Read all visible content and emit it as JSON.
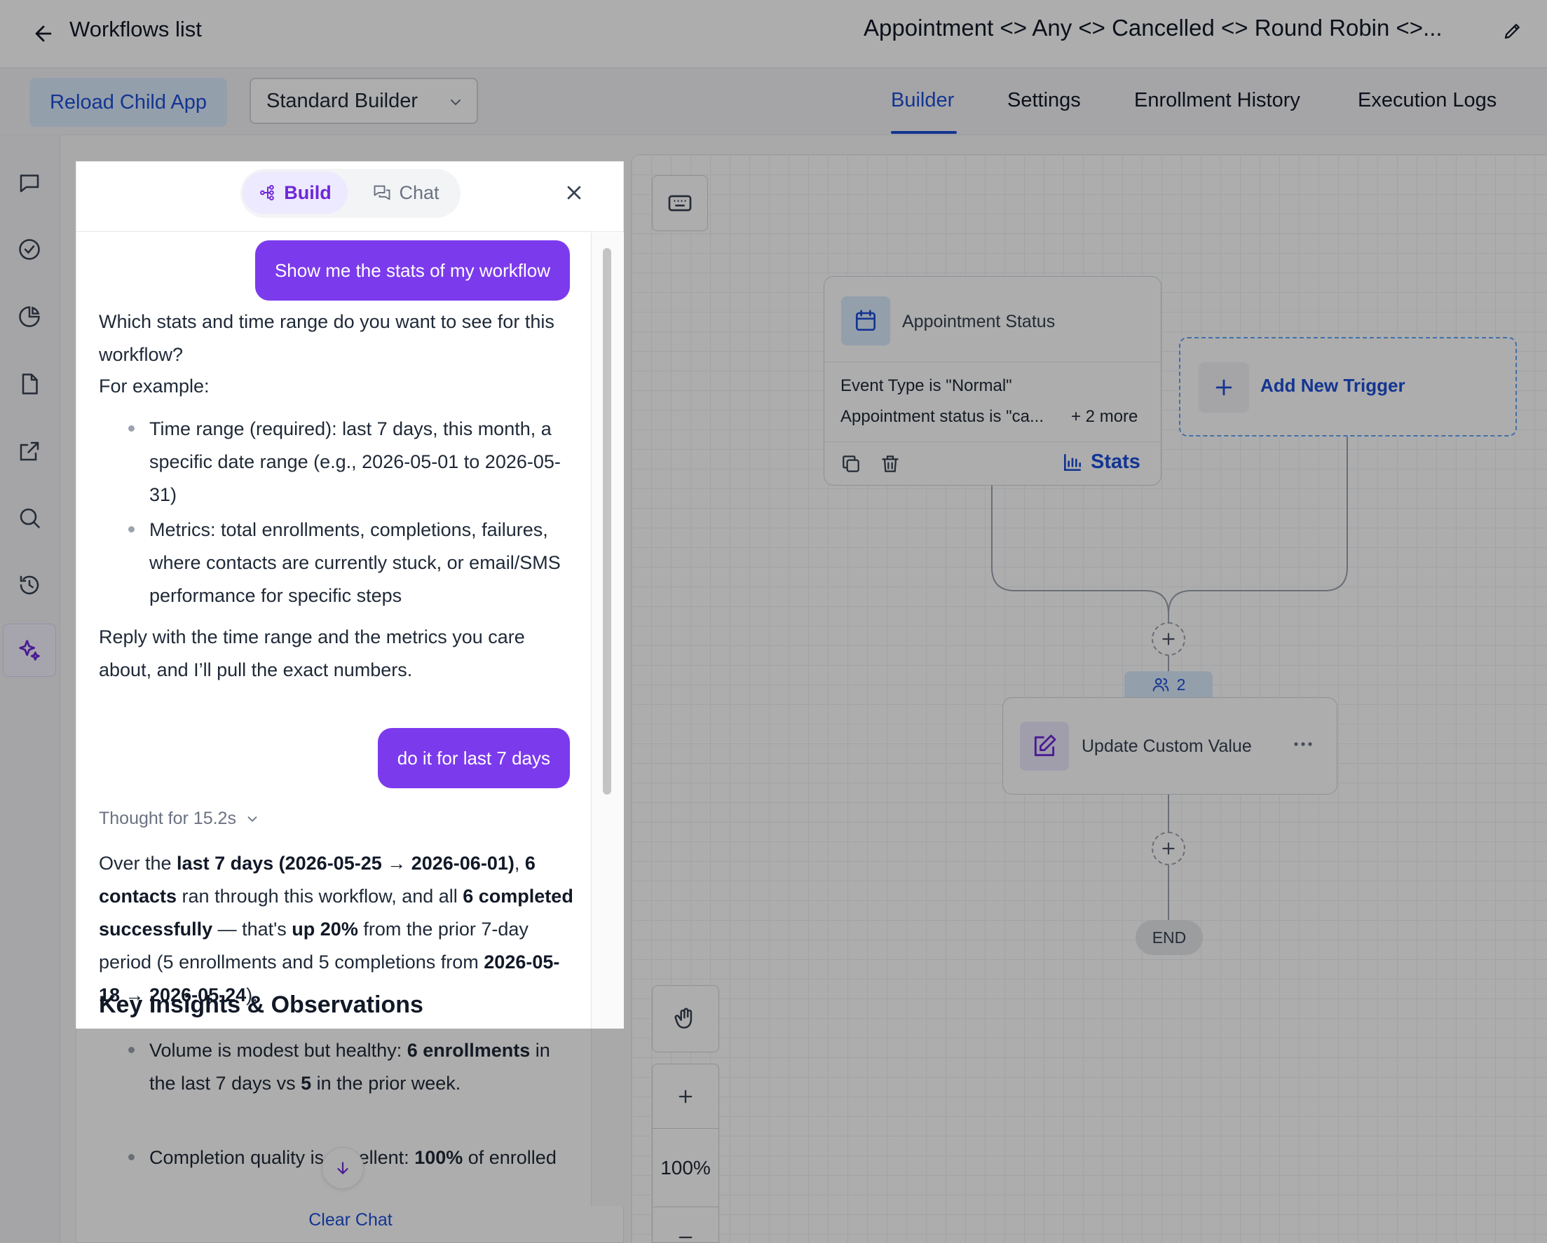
{
  "header": {
    "back_label": "Workflows list",
    "workflow_name": "Appointment <>  Any <> Cancelled <> Round Robin  <>..."
  },
  "toolbar": {
    "reload_label": "Reload Child App",
    "builder_select": "Standard Builder"
  },
  "tabs": [
    {
      "label": "Builder",
      "active": true
    },
    {
      "label": "Settings",
      "active": false
    },
    {
      "label": "Enrollment History",
      "active": false
    },
    {
      "label": "Execution Logs",
      "active": false
    }
  ],
  "rail": [
    "chat-icon",
    "check-circle-icon",
    "pie-chart-icon",
    "document-icon",
    "external-link-icon",
    "search-icon",
    "history-icon",
    "sparkle-icon"
  ],
  "panel": {
    "mode_build": "Build",
    "mode_chat": "Chat",
    "messages": {
      "user1": "Show me the stats of my workflow",
      "assistant1_intro": "Which stats and time range do you want to see for this workflow?",
      "assistant1_example": "For example:",
      "bullet1": "Time range (required): last 7 days, this month, a specific date range (e.g., 2026-05-01 to 2026-05-31)",
      "bullet2": "Metrics: total enrollments, completions, failures, where contacts are currently stuck, or email/SMS performance for specific steps",
      "assistant1_outro": "Reply with the time range and the metrics you care about, and I’ll pull the exact numbers.",
      "user2": "do it for last 7 days",
      "thought": "Thought for 15.2s",
      "a2_p1": "Over the ",
      "a2_b1": "last 7 days (2026-05-25 → 2026-06-01)",
      "a2_p2": ", ",
      "a2_b2": "6 contacts",
      "a2_p3": " ran through this workflow, and all ",
      "a2_b3": "6 completed successfully",
      "a2_p4": " — that's ",
      "a2_b4": "up 20%",
      "a2_p5": " from the prior 7-day period (5 enrollments and 5 completions from ",
      "a2_b5": "2026-05-18 → 2026-05-24",
      "a2_p6": ").",
      "insights_title": "Key Insights & Observations",
      "ins1_a": "Volume is modest but healthy: ",
      "ins1_b": "6 enrollments",
      "ins1_c": " in the last 7 days vs ",
      "ins1_d": "5",
      "ins1_e": " in the prior week.",
      "ins2_a": "Completion quality is excellent: ",
      "ins2_b": "100%",
      "ins2_c": " of enrolled"
    },
    "clear_label": "Clear Chat"
  },
  "canvas": {
    "trigger": {
      "title": "Appointment Status",
      "line1": "Event Type is \"Normal\"",
      "line2": "Appointment status is \"ca...",
      "more": "+ 2 more",
      "stats_label": "Stats"
    },
    "add_trigger_label": "Add New Trigger",
    "contacts_count": "2",
    "action_title": "Update Custom Value",
    "end_label": "END",
    "zoom": "100%"
  },
  "colors": {
    "accent": "#1d4ed8",
    "purple": "#7c3aed"
  }
}
